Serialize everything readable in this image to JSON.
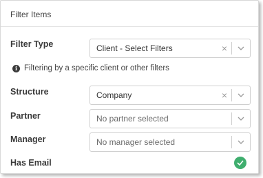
{
  "panel": {
    "title": "Filter Items"
  },
  "filter_type": {
    "label": "Filter Type",
    "value": "Client - Select Filters",
    "info_text": "Filtering by a specific client or other filters"
  },
  "structure": {
    "label": "Structure",
    "value": "Company"
  },
  "partner": {
    "label": "Partner",
    "placeholder": "No partner selected"
  },
  "manager": {
    "label": "Manager",
    "placeholder": "No manager selected"
  },
  "has_email": {
    "label": "Has Email",
    "checked": true
  },
  "icons": {
    "clear": "×",
    "info": "i"
  },
  "colors": {
    "check": "#3fae6e"
  }
}
